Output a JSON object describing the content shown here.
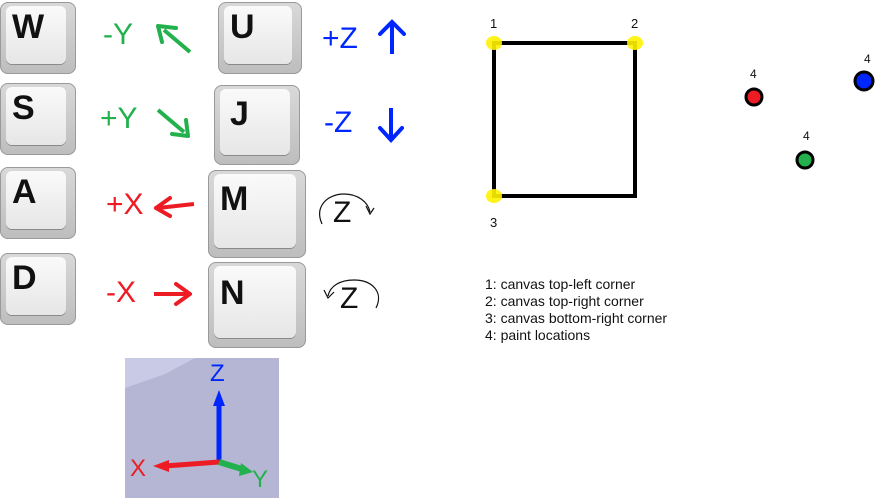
{
  "keys": [
    {
      "letter": "W",
      "axis": "-Y"
    },
    {
      "letter": "S",
      "axis": "+Y"
    },
    {
      "letter": "A",
      "axis": "+X"
    },
    {
      "letter": "D",
      "axis": "-X"
    },
    {
      "letter": "U",
      "axis": "+Z"
    },
    {
      "letter": "J",
      "axis": "-Z"
    },
    {
      "letter": "M",
      "axis": "Z"
    },
    {
      "letter": "N",
      "axis": "Z"
    }
  ],
  "axes_widget": {
    "z": "Z",
    "x": "X",
    "y": "Y"
  },
  "canvas_points": {
    "p1": "1",
    "p2": "2",
    "p3": "3"
  },
  "paint_points": [
    {
      "label": "4",
      "color": "#ed1c24"
    },
    {
      "label": "4",
      "color": "#0026ff"
    },
    {
      "label": "4",
      "color": "#22b14c"
    }
  ],
  "legend": [
    "1: canvas top-left corner",
    "2: canvas top-right corner",
    "3: canvas bottom-right corner",
    "4: paint locations"
  ],
  "colors": {
    "green": "#22b14c",
    "red": "#ed1c24",
    "blue": "#0026ff",
    "corner": "#fff200"
  }
}
